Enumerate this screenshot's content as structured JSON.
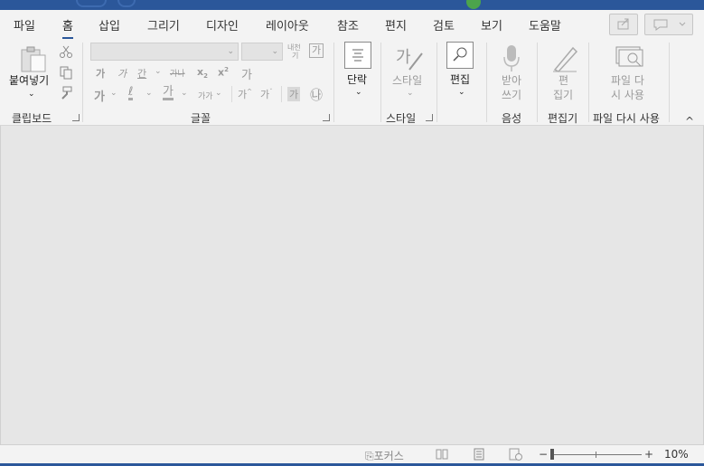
{
  "menu": {
    "tabs": [
      "파일",
      "홈",
      "삽입",
      "그리기",
      "디자인",
      "레이아웃",
      "참조",
      "편지",
      "검토",
      "보기",
      "도움말"
    ],
    "active_tab": "홈"
  },
  "ribbon": {
    "clipboard": {
      "paste_label": "붙여넣기",
      "group_label": "클립보드"
    },
    "font": {
      "font_name_value": "",
      "font_size_value": "",
      "ruby_label": "내천",
      "ruby_sub": "기",
      "char_border_glyph": "가",
      "bold_glyph": "가",
      "italic_glyph": "가",
      "underline_glyph": "간",
      "strike_glyph": "가나",
      "subscript_glyph": "x",
      "superscript_glyph": "x",
      "clear_format_glyph": "가",
      "text_effect_glyph": "가",
      "highlight_glyph": "ℓ",
      "font_color_glyph": "가",
      "change_case_glyph": "가가",
      "grow_font_glyph": "가",
      "shrink_font_glyph": "가",
      "char_shading_glyph": "가",
      "enclosed_char_glyph": "㉯",
      "group_label": "글꼴"
    },
    "paragraph": {
      "label": "단락"
    },
    "styles": {
      "label": "스타일",
      "group_label": "스타일"
    },
    "editing": {
      "label": "편집"
    },
    "voice": {
      "dictate_label_1": "받아",
      "dictate_label_2": "쓰기",
      "group_label": "음성"
    },
    "editor": {
      "label_1": "편",
      "label_2": "집기",
      "group_label": "편집기"
    },
    "reuse": {
      "label_1": "파일 다",
      "label_2": "시 사용",
      "group_label": "파일 다시 사용"
    }
  },
  "statusbar": {
    "focus_label": "포커스",
    "zoom_minus": "−",
    "zoom_plus": "+",
    "zoom_value": "10%",
    "zoom_level_percent": 10
  },
  "colors": {
    "accent": "#2b579a",
    "ribbon_bg": "#f3f3f3",
    "doc_bg": "#e6e6e6"
  }
}
